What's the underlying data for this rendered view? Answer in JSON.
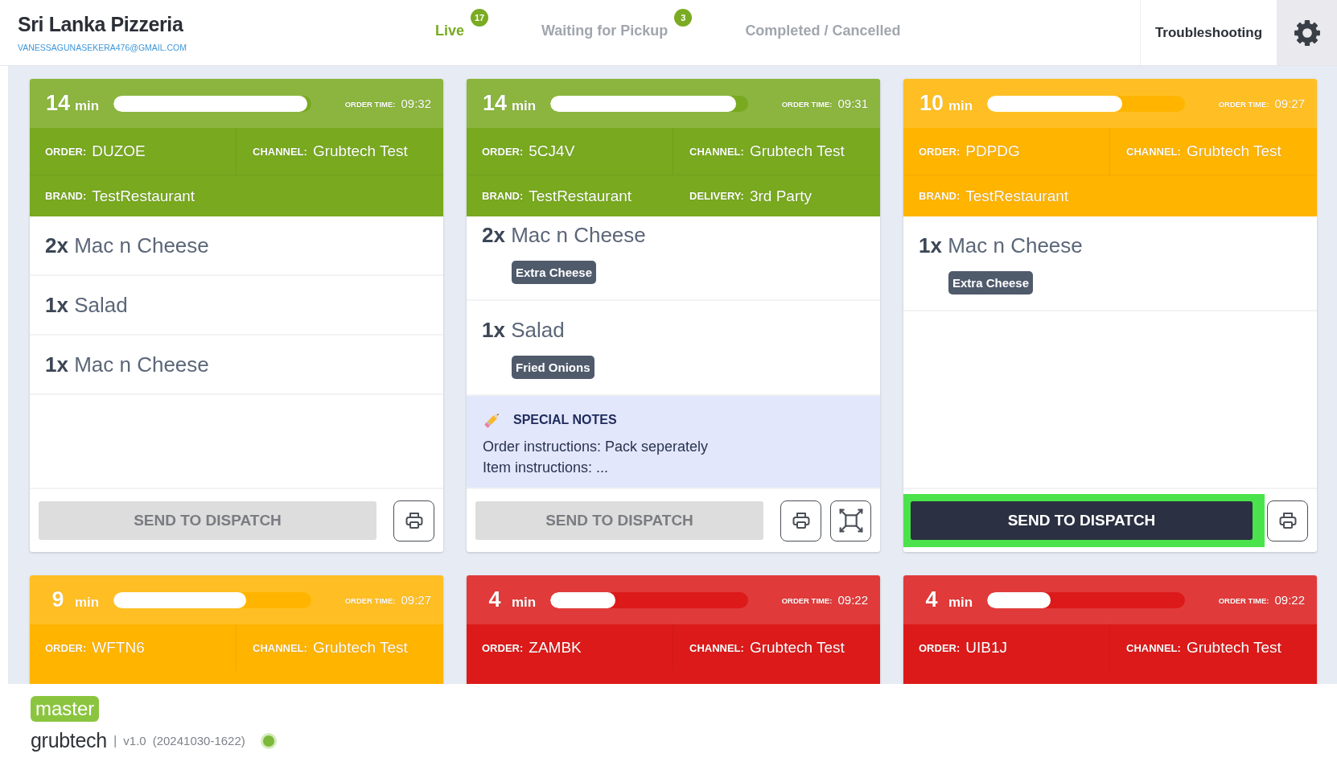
{
  "header": {
    "title": "Sri Lanka Pizzeria",
    "email": "VANESSAGUNASEKERA476@GMAIL.COM",
    "tabs": [
      {
        "label": "Live",
        "badge": "17",
        "selected": true
      },
      {
        "label": "Waiting for Pickup",
        "badge": "3",
        "selected": false
      },
      {
        "label": "Completed / Cancelled",
        "selected": false
      }
    ],
    "troubleshooting_button": "Troubleshooting"
  },
  "orders": [
    {
      "color": "#78a91f",
      "minutes": "14",
      "unit": "min",
      "level": 0.98,
      "order_time_label": "ORDER TIME:",
      "order_time": "09:32",
      "info_rows": [
        [
          {
            "label": "ORDER:",
            "value": "DUZOE"
          },
          {
            "label": "CHANNEL:",
            "value": "Grubtech Test"
          }
        ],
        [
          {
            "label": "BRAND:",
            "value": "TestRestaurant"
          }
        ]
      ],
      "items": [
        {
          "qty": "2x",
          "name": "Mac n Cheese"
        },
        {
          "qty": "1x",
          "name": "Salad"
        },
        {
          "qty": "1x",
          "name": "Mac n Cheese"
        }
      ],
      "dispatch": {
        "label": "SEND TO DISPATCH",
        "disabled": true,
        "highlighted": false
      },
      "tools": [
        {
          "kind": "print"
        }
      ]
    },
    {
      "color": "#78a91f",
      "minutes": "14",
      "unit": "min",
      "level": 0.94,
      "order_time_label": "ORDER TIME:",
      "order_time": "09:31",
      "info_rows": [
        [
          {
            "label": "ORDER:",
            "value": "5CJ4V"
          },
          {
            "label": "CHANNEL:",
            "value": "Grubtech Test"
          }
        ],
        [
          {
            "label": "BRAND:",
            "value": "TestRestaurant"
          },
          {
            "label": "DELIVERY:",
            "value": "3rd Party"
          }
        ]
      ],
      "items": [
        {
          "qty": "2x",
          "name": "Mac n Cheese",
          "modifiers": [
            "Extra Cheese"
          ]
        },
        {
          "qty": "1x",
          "name": "Salad",
          "modifiers": [
            "Fried Onions"
          ]
        }
      ],
      "notes": {
        "title": "SPECIAL NOTES",
        "lines": [
          "Order instructions: Pack seperately",
          "Item instructions: ..."
        ]
      },
      "dispatch": {
        "label": "SEND TO DISPATCH",
        "disabled": true,
        "highlighted": false
      },
      "tools": [
        {
          "kind": "print"
        },
        {
          "kind": "expand"
        }
      ]
    },
    {
      "color": "#ffb400",
      "minutes": "10",
      "unit": "min",
      "level": 0.68,
      "order_time_label": "ORDER TIME:",
      "order_time": "09:27",
      "info_rows": [
        [
          {
            "label": "ORDER:",
            "value": "PDPDG"
          },
          {
            "label": "CHANNEL:",
            "value": "Grubtech Test"
          }
        ],
        [
          {
            "label": "BRAND:",
            "value": "TestRestaurant"
          }
        ]
      ],
      "items": [
        {
          "qty": "1x",
          "name": "Mac n Cheese",
          "modifiers": [
            "Extra Cheese"
          ]
        }
      ],
      "dispatch": {
        "label": "SEND TO DISPATCH",
        "disabled": false,
        "highlighted": true
      },
      "tools": [
        {
          "kind": "print"
        }
      ]
    },
    {
      "color": "#ffb400",
      "minutes": "9",
      "unit": "min",
      "level": 0.67,
      "order_time_label": "ORDER TIME:",
      "order_time": "09:27",
      "info_rows": [
        [
          {
            "label": "ORDER:",
            "value": "WFTN6"
          },
          {
            "label": "CHANNEL:",
            "value": "Grubtech Test"
          }
        ]
      ]
    },
    {
      "color": "#dc1a1a",
      "minutes": "4",
      "unit": "min",
      "level": 0.33,
      "order_time_label": "ORDER TIME:",
      "order_time": "09:22",
      "info_rows": [
        [
          {
            "label": "ORDER:",
            "value": "ZAMBK"
          },
          {
            "label": "CHANNEL:",
            "value": "Grubtech Test"
          }
        ]
      ]
    },
    {
      "color": "#dc1a1a",
      "minutes": "4",
      "unit": "min",
      "level": 0.32,
      "order_time_label": "ORDER TIME:",
      "order_time": "09:22",
      "info_rows": [
        [
          {
            "label": "ORDER:",
            "value": "UIB1J"
          },
          {
            "label": "CHANNEL:",
            "value": "Grubtech Test"
          }
        ]
      ]
    }
  ],
  "footer": {
    "branch": "master",
    "brand": "grubtech",
    "separator": "|",
    "version": "v1.0",
    "build": "(20241030-1622)",
    "connected": true
  }
}
